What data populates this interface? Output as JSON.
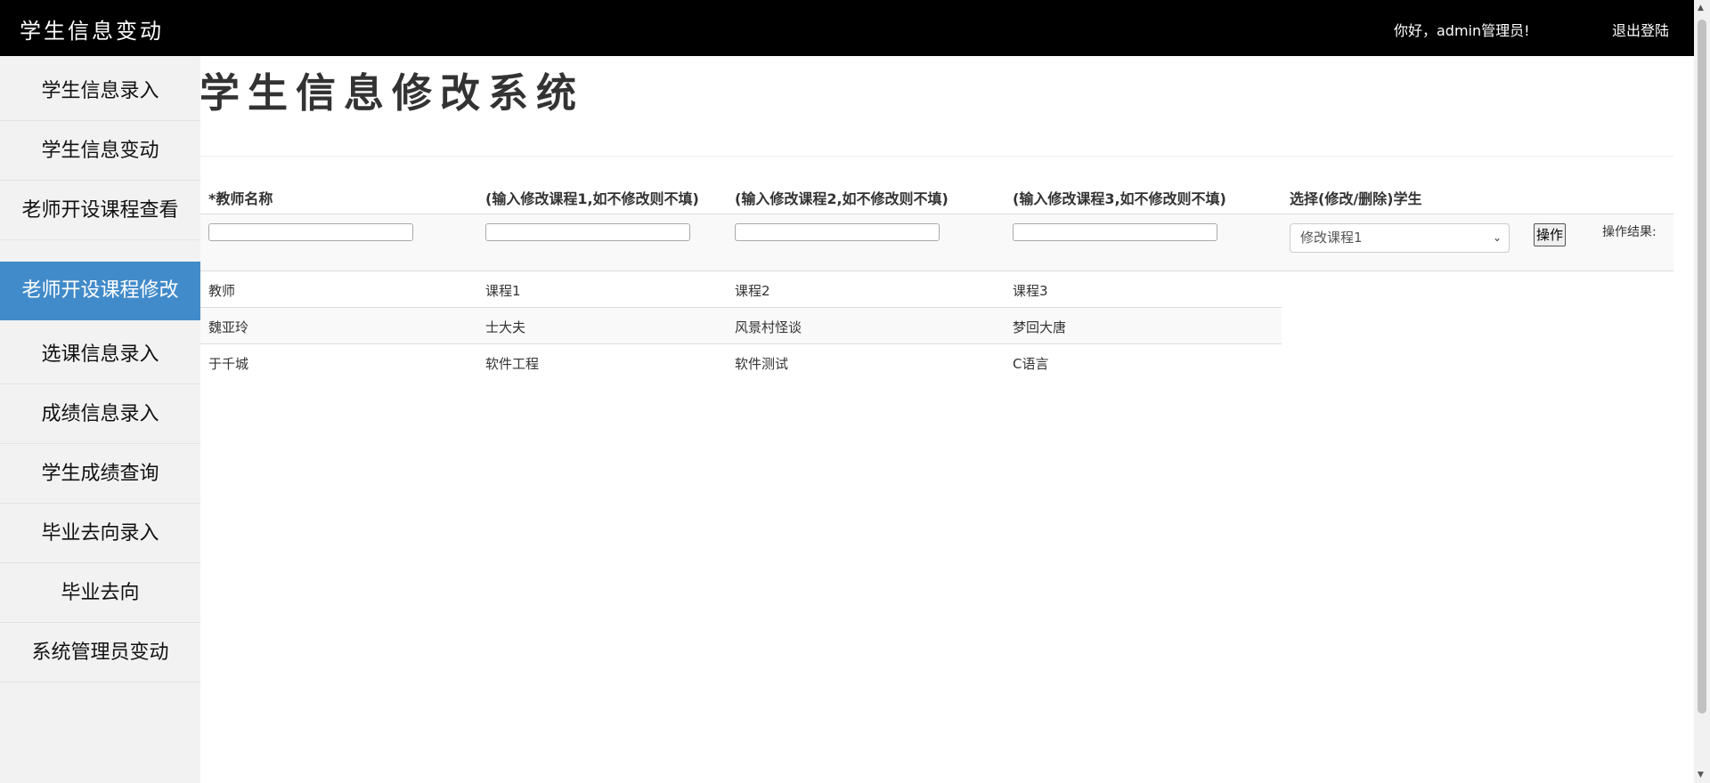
{
  "header": {
    "app_title": "学生信息变动",
    "greeting": "你好，admin管理员!",
    "logout": "退出登陆"
  },
  "sidebar": {
    "items": [
      {
        "label": "学生信息录入"
      },
      {
        "label": "学生信息变动"
      },
      {
        "label": "老师开设课程查看"
      },
      {
        "label": "老师开设课程修改",
        "active": true
      },
      {
        "label": "选课信息录入"
      },
      {
        "label": "成绩信息录入"
      },
      {
        "label": "学生成绩查询"
      },
      {
        "label": "毕业去向录入"
      },
      {
        "label": "毕业去向"
      },
      {
        "label": "系统管理员变动"
      }
    ]
  },
  "main": {
    "title": "学生信息修改系统",
    "form": {
      "headers": [
        "*教师名称",
        "(输入修改课程1,如不修改则不填)",
        "(输入修改课程2,如不修改则不填)",
        "(输入修改课程3,如不修改则不填)",
        "选择(修改/删除)学生"
      ],
      "inputs": [
        {
          "value": "",
          "placeholder": ""
        },
        {
          "value": "",
          "placeholder": ""
        },
        {
          "value": "",
          "placeholder": ""
        },
        {
          "value": "",
          "placeholder": ""
        }
      ],
      "select_value": "修改课程1",
      "button_label": "操作",
      "result_label": "操作结果:"
    },
    "table": {
      "columns": [
        "教师",
        "课程1",
        "课程2",
        "课程3"
      ],
      "rows": [
        [
          "魏亚玲",
          "士大夫",
          "风景村怪谈",
          "梦回大唐"
        ],
        [
          "于千城",
          "软件工程",
          "软件测试",
          "C语言"
        ]
      ]
    }
  },
  "colors": {
    "topbar": "#000000",
    "sidebar_bg": "#f2f2f2",
    "active_item": "#428bca"
  },
  "icons": {
    "select_chevron": "chevron-down-icon",
    "scroll_up": "scroll-up-arrow-icon",
    "scroll_down": "scroll-down-arrow-icon"
  }
}
